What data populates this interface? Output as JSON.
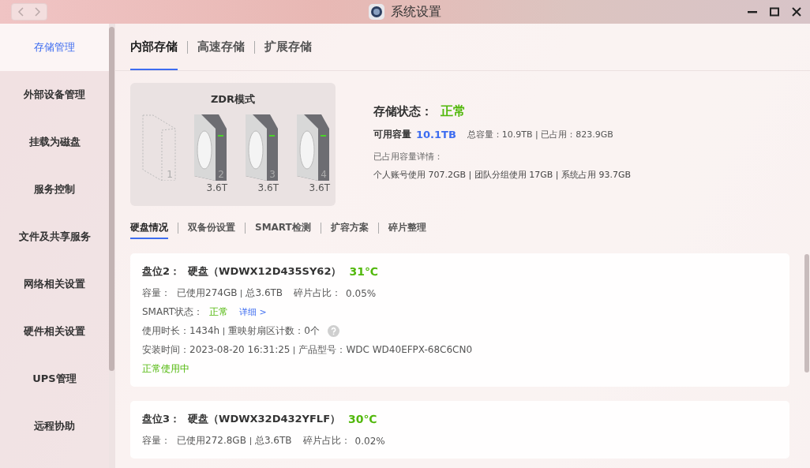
{
  "window": {
    "title": "系统设置"
  },
  "sidebar": {
    "items": [
      {
        "label": "存储管理",
        "selected": true
      },
      {
        "label": "外部设备管理",
        "selected": false
      },
      {
        "label": "挂载为磁盘",
        "selected": false
      },
      {
        "label": "服务控制",
        "selected": false
      },
      {
        "label": "文件及共享服务",
        "selected": false
      },
      {
        "label": "网络相关设置",
        "selected": false
      },
      {
        "label": "硬件相关设置",
        "selected": false
      },
      {
        "label": "UPS管理",
        "selected": false
      },
      {
        "label": "远程协助",
        "selected": false
      }
    ]
  },
  "tabs": [
    {
      "label": "内部存储",
      "selected": true
    },
    {
      "label": "高速存储",
      "selected": false
    },
    {
      "label": "扩展存储",
      "selected": false
    }
  ],
  "array": {
    "mode": "ZDR模式",
    "bays": [
      {
        "kind": "empty",
        "number": "1"
      },
      {
        "kind": "disk",
        "number": "2",
        "size": "3.6T"
      },
      {
        "kind": "disk",
        "number": "3",
        "size": "3.6T"
      },
      {
        "kind": "disk",
        "number": "4",
        "size": "3.6T"
      }
    ]
  },
  "status": {
    "label": "存储状态：",
    "value": "正常",
    "available_label": "可用容量",
    "available_value": "10.1TB",
    "totals": "总容量：10.9TB | 已占用：823.9GB",
    "detail_label": "已占用容量详情：",
    "detail": "个人账号使用 707.2GB | 团队分组使用 17GB | 系统占用 93.7GB"
  },
  "subtabs": [
    {
      "label": "硬盘情况",
      "selected": true
    },
    {
      "label": "双备份设置",
      "selected": false
    },
    {
      "label": "SMART检测",
      "selected": false
    },
    {
      "label": "扩容方案",
      "selected": false
    },
    {
      "label": "碎片整理",
      "selected": false
    }
  ],
  "disks": [
    {
      "slot": "盘位2：",
      "name": "硬盘（WDWX12D435SY62）",
      "temperature": "31℃",
      "capacity_label": "容量：",
      "used": "已使用274GB",
      "total": "总3.6TB",
      "fragment_label": "碎片占比：",
      "fragment": "0.05%",
      "smart_label": "SMART状态：",
      "smart_value": "正常",
      "smart_link": "详细 >",
      "hours": "使用时长：1434h",
      "remapped": "重映射扇区计数：0个",
      "installed": "安装时间：2023-08-20 16:31:25",
      "model": "产品型号：WDC WD40EFPX-68C6CN0",
      "state": "正常使用中"
    },
    {
      "slot": "盘位3：",
      "name": "硬盘（WDWX32D432YFLF）",
      "temperature": "30℃",
      "capacity_label": "容量：",
      "used": "已使用272.8GB",
      "total": "总3.6TB",
      "fragment_label": "碎片占比：",
      "fragment": "0.02%"
    }
  ]
}
